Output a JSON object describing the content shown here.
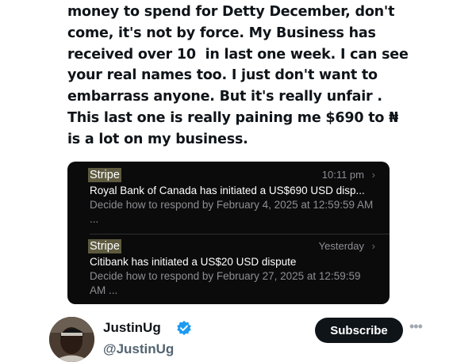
{
  "post": {
    "lines": [
      "money to spend for Detty December, don't",
      "come, it's not by force. My Business has",
      "received over 10  in last one week. I can see",
      "your real names too. I just don't want to",
      "embarrass anyone. But it's really unfair .",
      "This last one is really paining me $690 to ₦",
      "is a lot on my business."
    ]
  },
  "notifications": [
    {
      "app": "Stripe",
      "time": "10:11 pm",
      "chevron": "›",
      "title": "Royal Bank of Canada has initiated a US$690 USD disp...",
      "body": "Decide how to respond by February 4, 2025 at 12:59:59 AM ..."
    },
    {
      "app": "Stripe",
      "time": "Yesterday",
      "chevron": "›",
      "title": "Citibank has initiated a US$20 USD dispute",
      "body": "Decide how to respond by February 27, 2025 at 12:59:59 AM ..."
    }
  ],
  "author": {
    "name": "JustinUg",
    "handle": "@JustinUg",
    "subscribe_label": "Subscribe",
    "more_label": "•••",
    "verified_color": "#1d9bf0"
  }
}
